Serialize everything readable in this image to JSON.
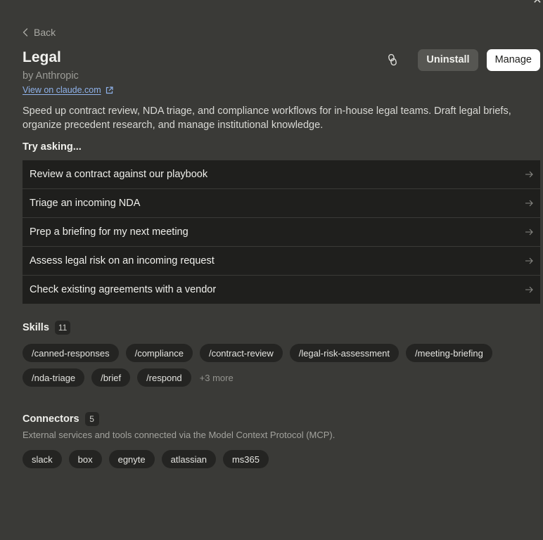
{
  "window": {
    "close_icon": "close-icon"
  },
  "nav": {
    "back_label": "Back"
  },
  "plugin": {
    "name": "Legal",
    "author": "by Anthropic",
    "view_link": "View on claude.com",
    "description": "Speed up contract review, NDA triage, and compliance workflows for in-house legal teams. Draft legal briefs, organize precedent research, and manage institutional knowledge."
  },
  "actions": {
    "link_icon": "link-icon",
    "uninstall_label": "Uninstall",
    "manage_label": "Manage"
  },
  "try_asking": {
    "heading": "Try asking...",
    "prompts": [
      "Review a contract against our playbook",
      "Triage an incoming NDA",
      "Prep a briefing for my next meeting",
      "Assess legal risk on an incoming request",
      "Check existing agreements with a vendor"
    ]
  },
  "skills": {
    "heading": "Skills",
    "count": "11",
    "items": [
      "/canned-responses",
      "/compliance",
      "/contract-review",
      "/legal-risk-assessment",
      "/meeting-briefing",
      "/nda-triage",
      "/brief",
      "/respond"
    ],
    "more_label": "+3 more"
  },
  "connectors": {
    "heading": "Connectors",
    "count": "5",
    "subtitle": "External services and tools connected via the Model Context Protocol (MCP).",
    "items": [
      "slack",
      "box",
      "egnyte",
      "atlassian",
      "ms365"
    ]
  },
  "colors": {
    "background": "#3a3a37",
    "row_background": "#1f1f1d",
    "chip_background": "#242422",
    "link": "#8fb2ea",
    "primary_button": "#ffffff"
  }
}
